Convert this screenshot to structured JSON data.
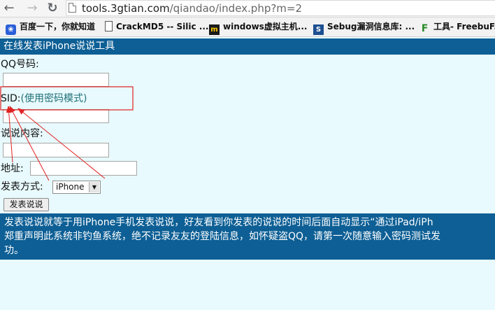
{
  "browser": {
    "url_host": "tools.3gtian.com",
    "url_path": "/qiandao/index.php?m=2",
    "bookmarks": [
      {
        "label": "百度一下，你就知道",
        "icon": "baidu-paw-icon"
      },
      {
        "label": "CrackMD5 -- Silic ...",
        "icon": "page-icon"
      },
      {
        "label": "windows虚拟主机...",
        "icon": "m-logo-icon"
      },
      {
        "label": "Sebug漏洞信息库: ...",
        "icon": "s-logo-icon"
      },
      {
        "label": "工具- FreebuF.C",
        "icon": "f-logo-icon"
      }
    ]
  },
  "page": {
    "title": "在线发表iPhone说说工具",
    "qq_label": "QQ号码:",
    "sid_label": "SID:",
    "sid_hint": "(使用密码模式)",
    "content_label": "说说内容:",
    "address_label": "地址:",
    "method_label": "发表方式:",
    "method_selected": "iPhone",
    "submit_label": "发表说说",
    "info_lines": [
      "发表说说就等于用iPhone手机发表说说，好友看到你发表的说说的时间后面自动显示“通过iPad/iPh",
      "郑重声明此系统非钓鱼系统，绝不记录友友的登陆信息，如怀疑盗QQ，请第一次随意输入密码测试发",
      "功。"
    ]
  },
  "colors": {
    "header_bg": "#0d5f95",
    "page_bg": "#e8fafd",
    "annotation": "#e02020"
  }
}
